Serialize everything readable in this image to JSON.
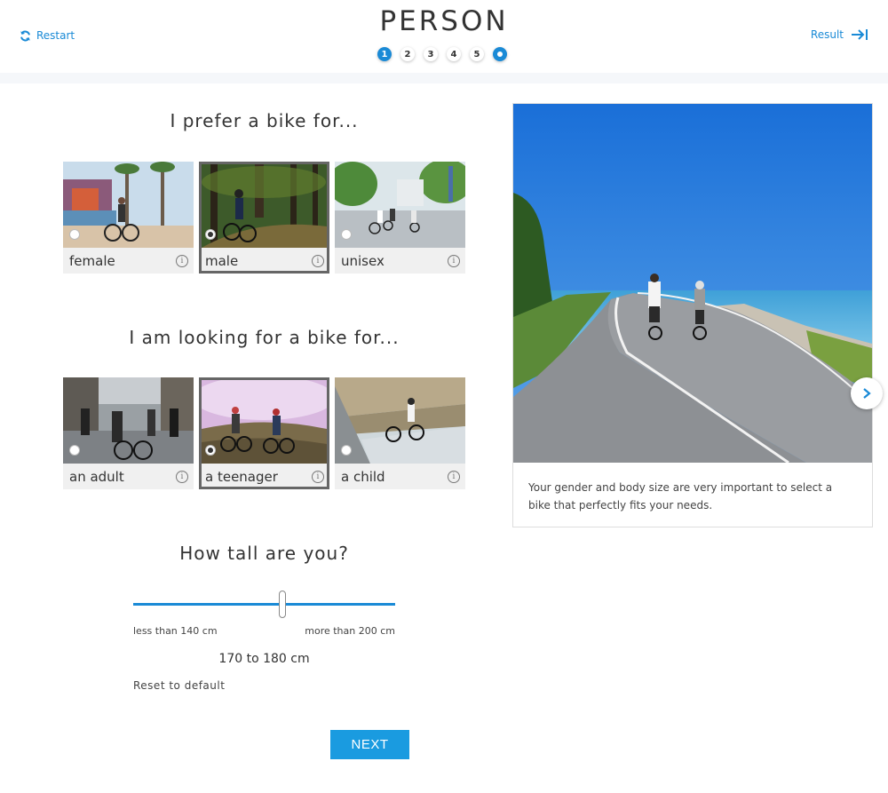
{
  "header": {
    "restart_label": "Restart",
    "title": "PERSON",
    "result_label": "Result",
    "steps": [
      "1",
      "2",
      "3",
      "4",
      "5",
      ""
    ],
    "active_step": 1,
    "accent": "#1a8ad6"
  },
  "gender": {
    "heading": "I prefer a bike for...",
    "options": [
      {
        "label": "female",
        "selected": false
      },
      {
        "label": "male",
        "selected": true
      },
      {
        "label": "unisex",
        "selected": false
      }
    ]
  },
  "age": {
    "heading": "I am looking for a bike for...",
    "options": [
      {
        "label": "an adult",
        "selected": false
      },
      {
        "label": "a teenager",
        "selected": true
      },
      {
        "label": "a child",
        "selected": false
      }
    ]
  },
  "height": {
    "heading": "How tall are you?",
    "min_label": "less than 140 cm",
    "max_label": "more than 200 cm",
    "value_label": "170 to 180 cm",
    "level": 0.57,
    "reset_label": "Reset to default"
  },
  "next_label": "NEXT",
  "panel": {
    "caption": "Your gender and body size are very important to select a bike that perfectly fits your needs."
  },
  "icons": {
    "restart": "refresh-icon",
    "result": "arrow-to-right-icon",
    "info": "info-icon",
    "next_photo": "chevron-right-icon"
  },
  "info_glyph": "i"
}
